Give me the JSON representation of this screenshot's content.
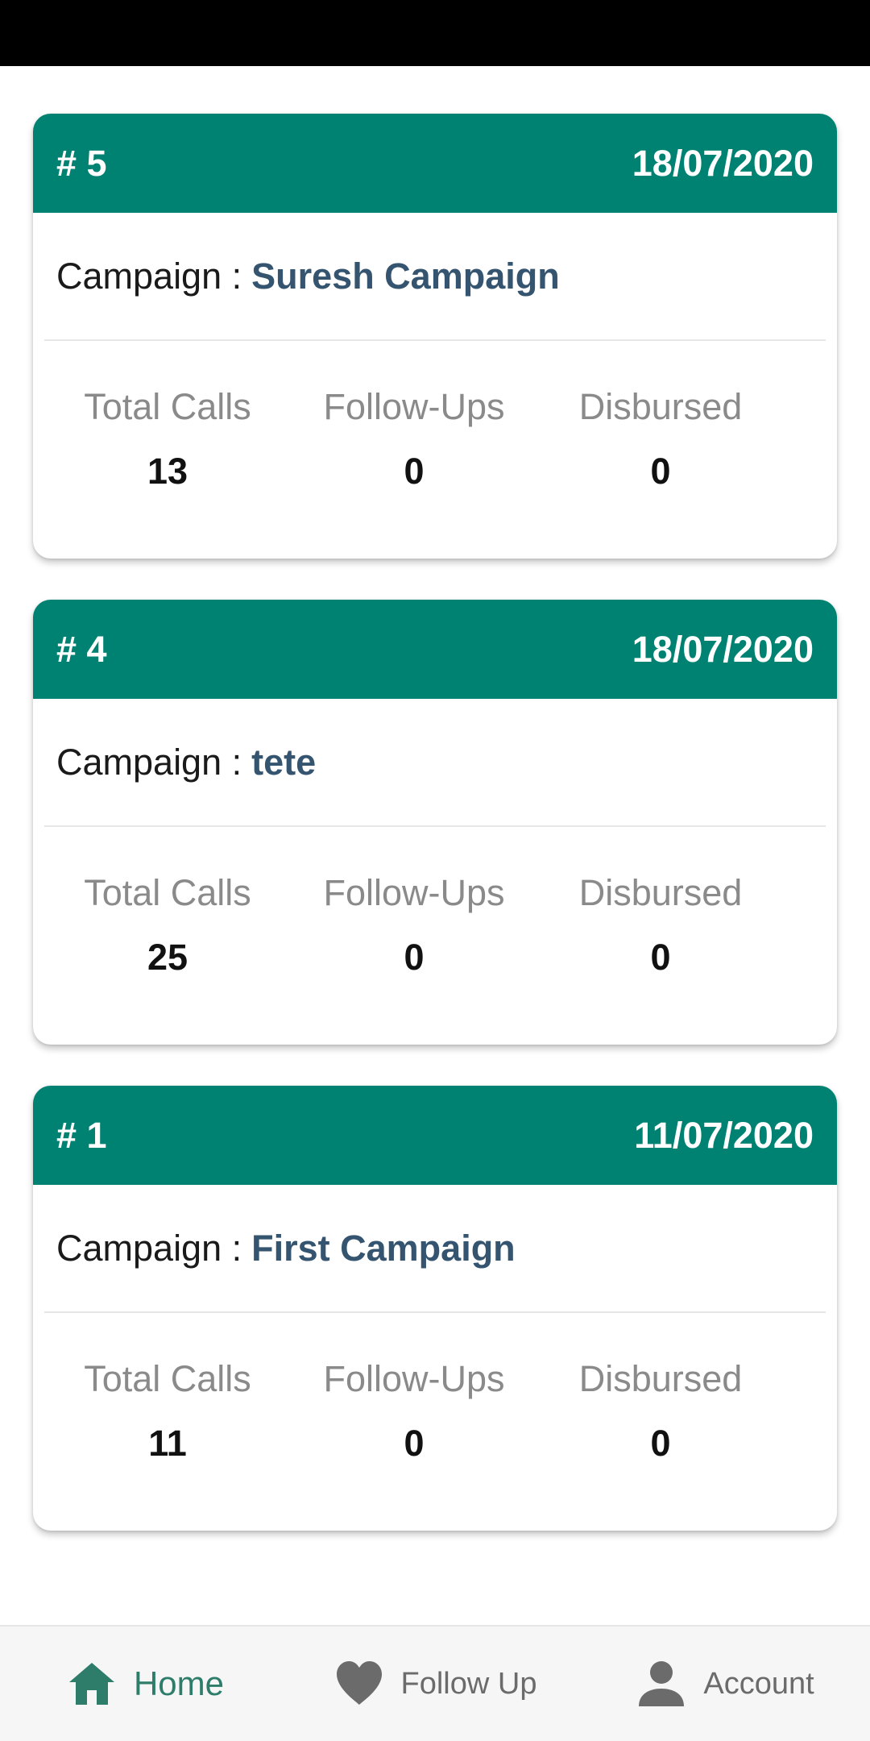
{
  "cards": [
    {
      "id": "# 5",
      "date": "18/07/2020",
      "campaign_label": "Campaign :",
      "campaign_name": "Suresh Campaign",
      "stats": [
        {
          "label": "Total Calls",
          "value": "13"
        },
        {
          "label": "Follow-Ups",
          "value": "0"
        },
        {
          "label": "Disbursed",
          "value": "0"
        }
      ]
    },
    {
      "id": "# 4",
      "date": "18/07/2020",
      "campaign_label": "Campaign :",
      "campaign_name": "tete",
      "stats": [
        {
          "label": "Total Calls",
          "value": "25"
        },
        {
          "label": "Follow-Ups",
          "value": "0"
        },
        {
          "label": "Disbursed",
          "value": "0"
        }
      ]
    },
    {
      "id": "# 1",
      "date": "11/07/2020",
      "campaign_label": "Campaign :",
      "campaign_name": "First Campaign",
      "stats": [
        {
          "label": "Total Calls",
          "value": "11"
        },
        {
          "label": "Follow-Ups",
          "value": "0"
        },
        {
          "label": "Disbursed",
          "value": "0"
        }
      ]
    }
  ],
  "bottom_nav": [
    {
      "label": "Home",
      "icon": "home-icon",
      "active": true
    },
    {
      "label": "Follow Up",
      "icon": "heart-icon",
      "active": false
    },
    {
      "label": "Account",
      "icon": "person-icon",
      "active": false
    }
  ],
  "colors": {
    "header": "#008272",
    "campaign_name": "#34546f",
    "nav_active": "#2e7d6b",
    "nav_inactive": "#6b6b6b"
  }
}
